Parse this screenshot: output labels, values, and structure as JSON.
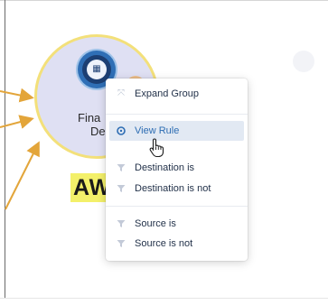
{
  "node": {
    "label_line1": "Fina",
    "label_line2": "De",
    "icon": "building-icon",
    "group_tag": "AW"
  },
  "context_menu": {
    "items": [
      {
        "label": "Expand Group",
        "icon": "expand-icon"
      },
      {
        "label": "View Rule",
        "icon": "info-icon",
        "active": true
      },
      {
        "label": "Destination is",
        "icon": "filter-icon"
      },
      {
        "label": "Destination is not",
        "icon": "filter-icon"
      },
      {
        "label": "Source is",
        "icon": "filter-icon"
      },
      {
        "label": "Source is not",
        "icon": "filter-icon"
      }
    ]
  },
  "colors": {
    "node_fill": "#dfe0f3",
    "node_border": "#f3e07a",
    "edge": "#e3a53a",
    "highlight_tag": "#f3f06a",
    "menu_active_bg": "#e2e9f3",
    "menu_active_text": "#2d6db3"
  }
}
